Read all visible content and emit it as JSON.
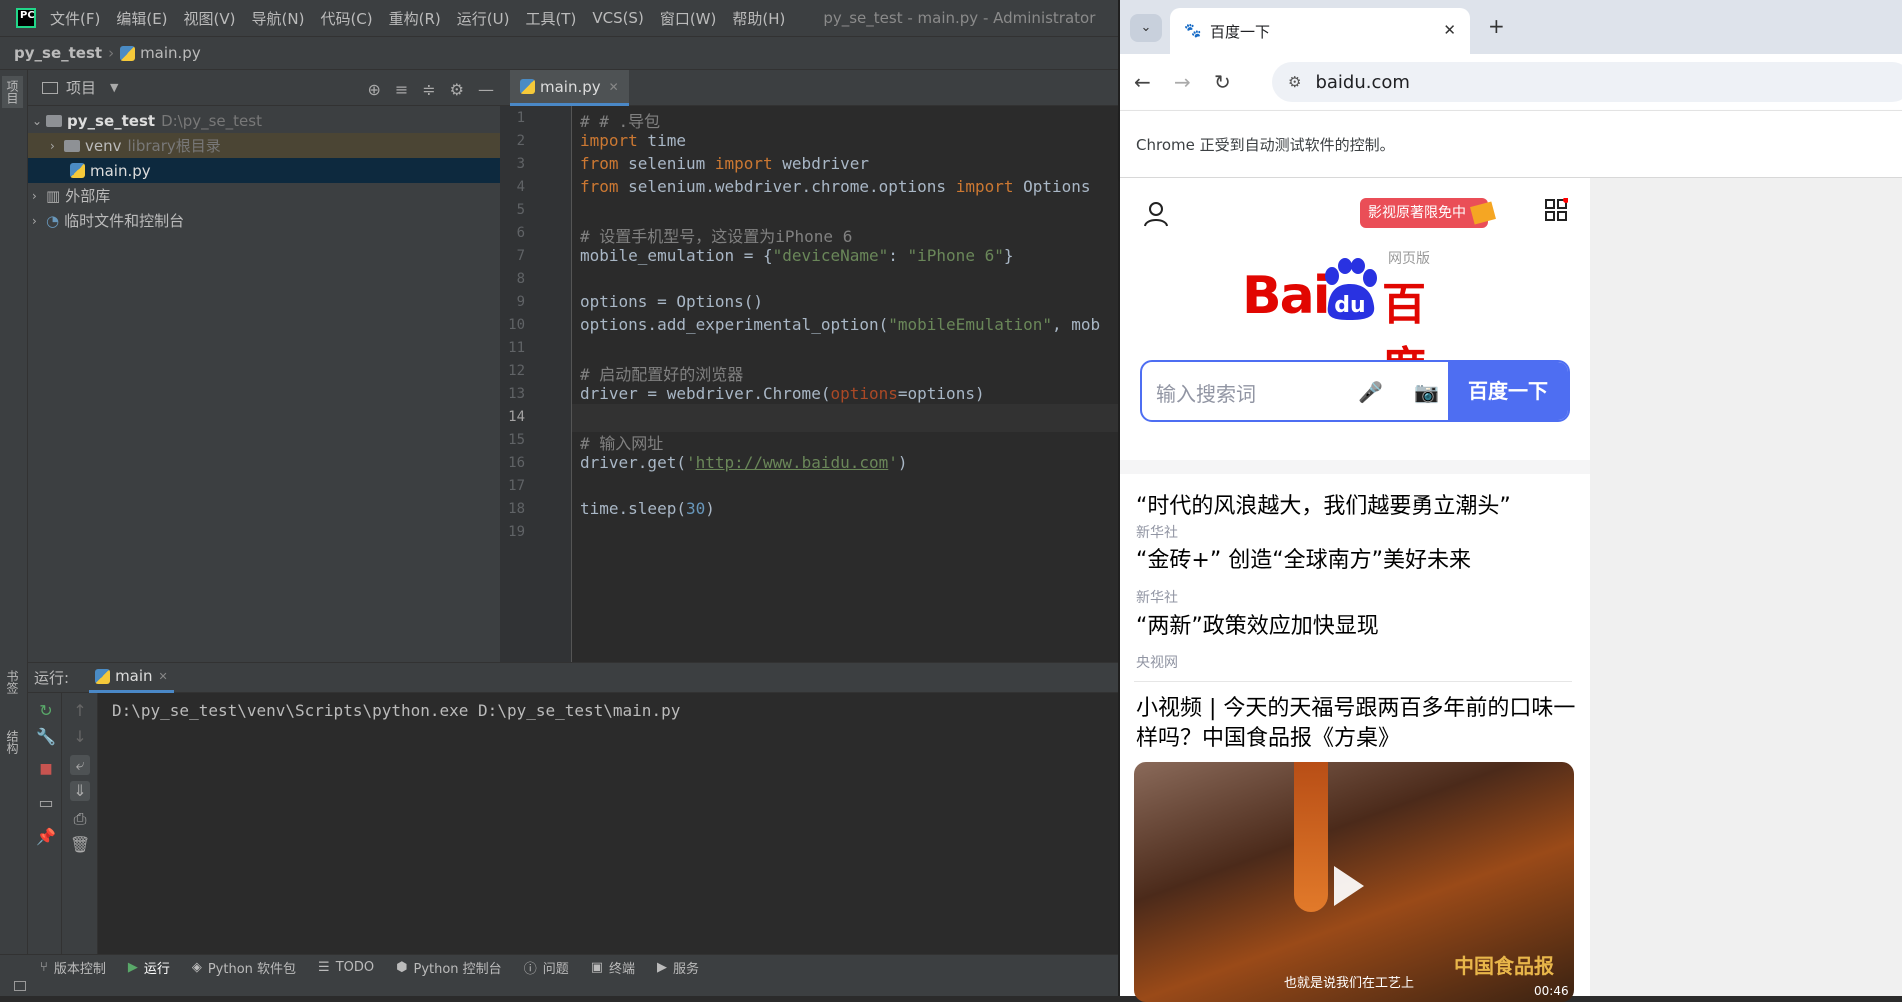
{
  "ide": {
    "menu": [
      "文件(F)",
      "编辑(E)",
      "视图(V)",
      "导航(N)",
      "代码(C)",
      "重构(R)",
      "运行(U)",
      "工具(T)",
      "VCS(S)",
      "窗口(W)",
      "帮助(H)"
    ],
    "window_title": "py_se_test - main.py - Administrator",
    "breadcrumb": {
      "project": "py_se_test",
      "file": "main.py"
    },
    "left_strip": {
      "project_tab": "项目",
      "bookmarks_tab": "书签",
      "structure_tab": "结构"
    },
    "project_panel": {
      "title": "项目",
      "root_name": "py_se_test",
      "root_path": "D:\\py_se_test",
      "venv": "venv",
      "venv_note": "library根目录",
      "file": "main.py",
      "external_libs": "外部库",
      "scratches": "临时文件和控制台"
    },
    "editor": {
      "tab": "main.py",
      "lines": [
        "1",
        "2",
        "3",
        "4",
        "5",
        "6",
        "7",
        "8",
        "9",
        "10",
        "11",
        "12",
        "13",
        "14",
        "15",
        "16",
        "17",
        "18",
        "19"
      ],
      "current_line": "14",
      "code": {
        "l1": "# # .导包",
        "l2_kw": "import",
        "l2_rest": " time",
        "l3_kw1": "from",
        "l3_mid": " selenium ",
        "l3_kw2": "import",
        "l3_rest": " webdriver",
        "l4_kw1": "from",
        "l4_mid": " selenium.webdriver.chrome.options ",
        "l4_kw2": "import",
        "l4_rest": " Options",
        "l6": "# 设置手机型号，这设置为iPhone 6",
        "l7_a": "mobile_emulation = {",
        "l7_s1": "\"deviceName\"",
        "l7_b": ": ",
        "l7_s2": "\"iPhone 6\"",
        "l7_c": "}",
        "l9": "options = Options()",
        "l10_a": "options.add_experimental_option(",
        "l10_s": "\"mobileEmulation\"",
        "l10_b": ", mob",
        "l12": "# 启动配置好的浏览器",
        "l13_a": "driver = webdriver.Chrome(",
        "l13_p": "options",
        "l13_b": "=options)",
        "l15": "# 输入网址",
        "l16_a": "driver.get(",
        "l16_q1": "'",
        "l16_url": "http://www.baidu.com",
        "l16_q2": "'",
        "l16_b": ")",
        "l18_a": "time.sleep(",
        "l18_n": "30",
        "l18_b": ")"
      }
    },
    "run": {
      "label": "运行:",
      "tab": "main",
      "output": "D:\\py_se_test\\venv\\Scripts\\python.exe D:\\py_se_test\\main.py"
    },
    "tool_tabs": [
      "版本控制",
      "运行",
      "Python 软件包",
      "TODO",
      "Python 控制台",
      "问题",
      "终端",
      "服务"
    ]
  },
  "browser": {
    "tab_title": "百度一下",
    "url": "baidu.com",
    "infobar": "Chrome 正受到自动测试软件的控制。",
    "page": {
      "promo": "影视原著限免中",
      "logo_tag": "网页版",
      "logo_bai": "Bai",
      "logo_du": "du",
      "logo_cn": "百度",
      "search_placeholder": "输入搜索词",
      "search_button": "百度一下",
      "news": [
        {
          "title": "“时代的风浪越大，我们越要勇立潮头”",
          "source": "新华社"
        },
        {
          "title": "“金砖+” 创造“全球南方”美好未来",
          "source": "新华社"
        },
        {
          "title": "“两新”政策效应加快显现",
          "source": "央视网"
        }
      ],
      "video_title": "小视频 | 今天的天福号跟两百多年前的口味一样吗？中国食品报《方桌》",
      "video_caption": "也就是说我们在工艺上",
      "video_brand": "中国食品报",
      "video_time": "00:46"
    }
  }
}
